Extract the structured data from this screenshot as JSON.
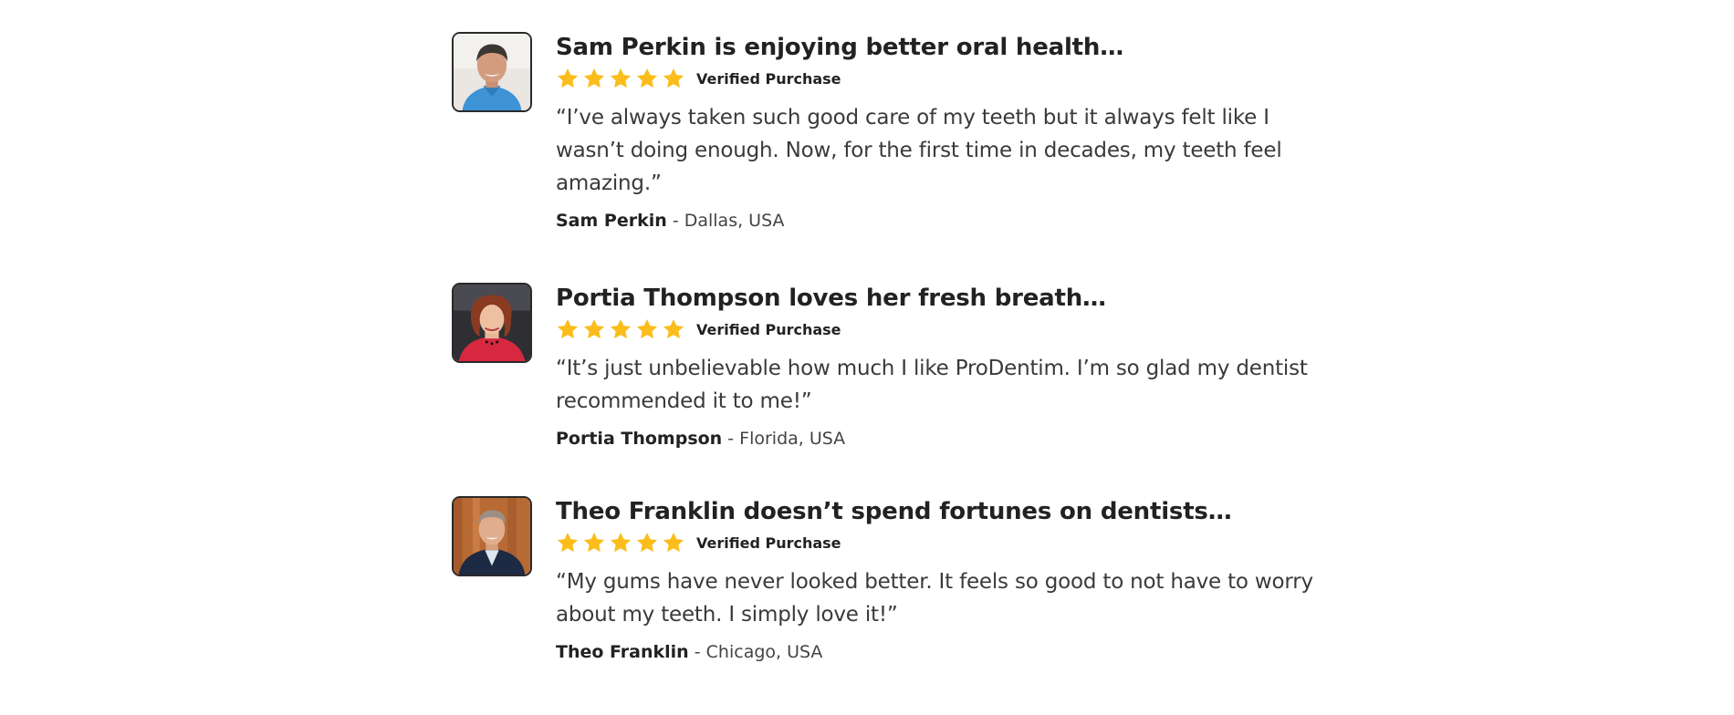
{
  "reviews": [
    {
      "headline": "Sam Perkin is enjoying better oral health…",
      "rating": 5,
      "verified_label": "Verified Purchase",
      "quote": "“I’ve always taken such good care of my teeth but it always felt like I wasn’t doing enough. Now, for the first time in decades, my teeth feel amazing.”",
      "author": "Sam Perkin",
      "separator": " - ",
      "location": "Dallas, USA"
    },
    {
      "headline": "Portia Thompson loves her fresh breath…",
      "rating": 5,
      "verified_label": "Verified Purchase",
      "quote": "“It’s just unbelievable how much I like ProDentim. I’m so glad my dentist recommended it to me!”",
      "author": "Portia Thompson",
      "separator": " - ",
      "location": "Florida, USA"
    },
    {
      "headline": "Theo Franklin doesn’t spend fortunes on dentists…",
      "rating": 5,
      "verified_label": "Verified Purchase",
      "quote": "“My gums have never looked better. It feels so good to not have to worry about my teeth. I simply love it!”",
      "author": "Theo Franklin",
      "separator": " - ",
      "location": "Chicago, USA"
    }
  ],
  "colors": {
    "star": "#fbbd1b",
    "heading": "#222222",
    "body_text": "#3a3a3a",
    "avatar_border": "#2a2a2a"
  }
}
